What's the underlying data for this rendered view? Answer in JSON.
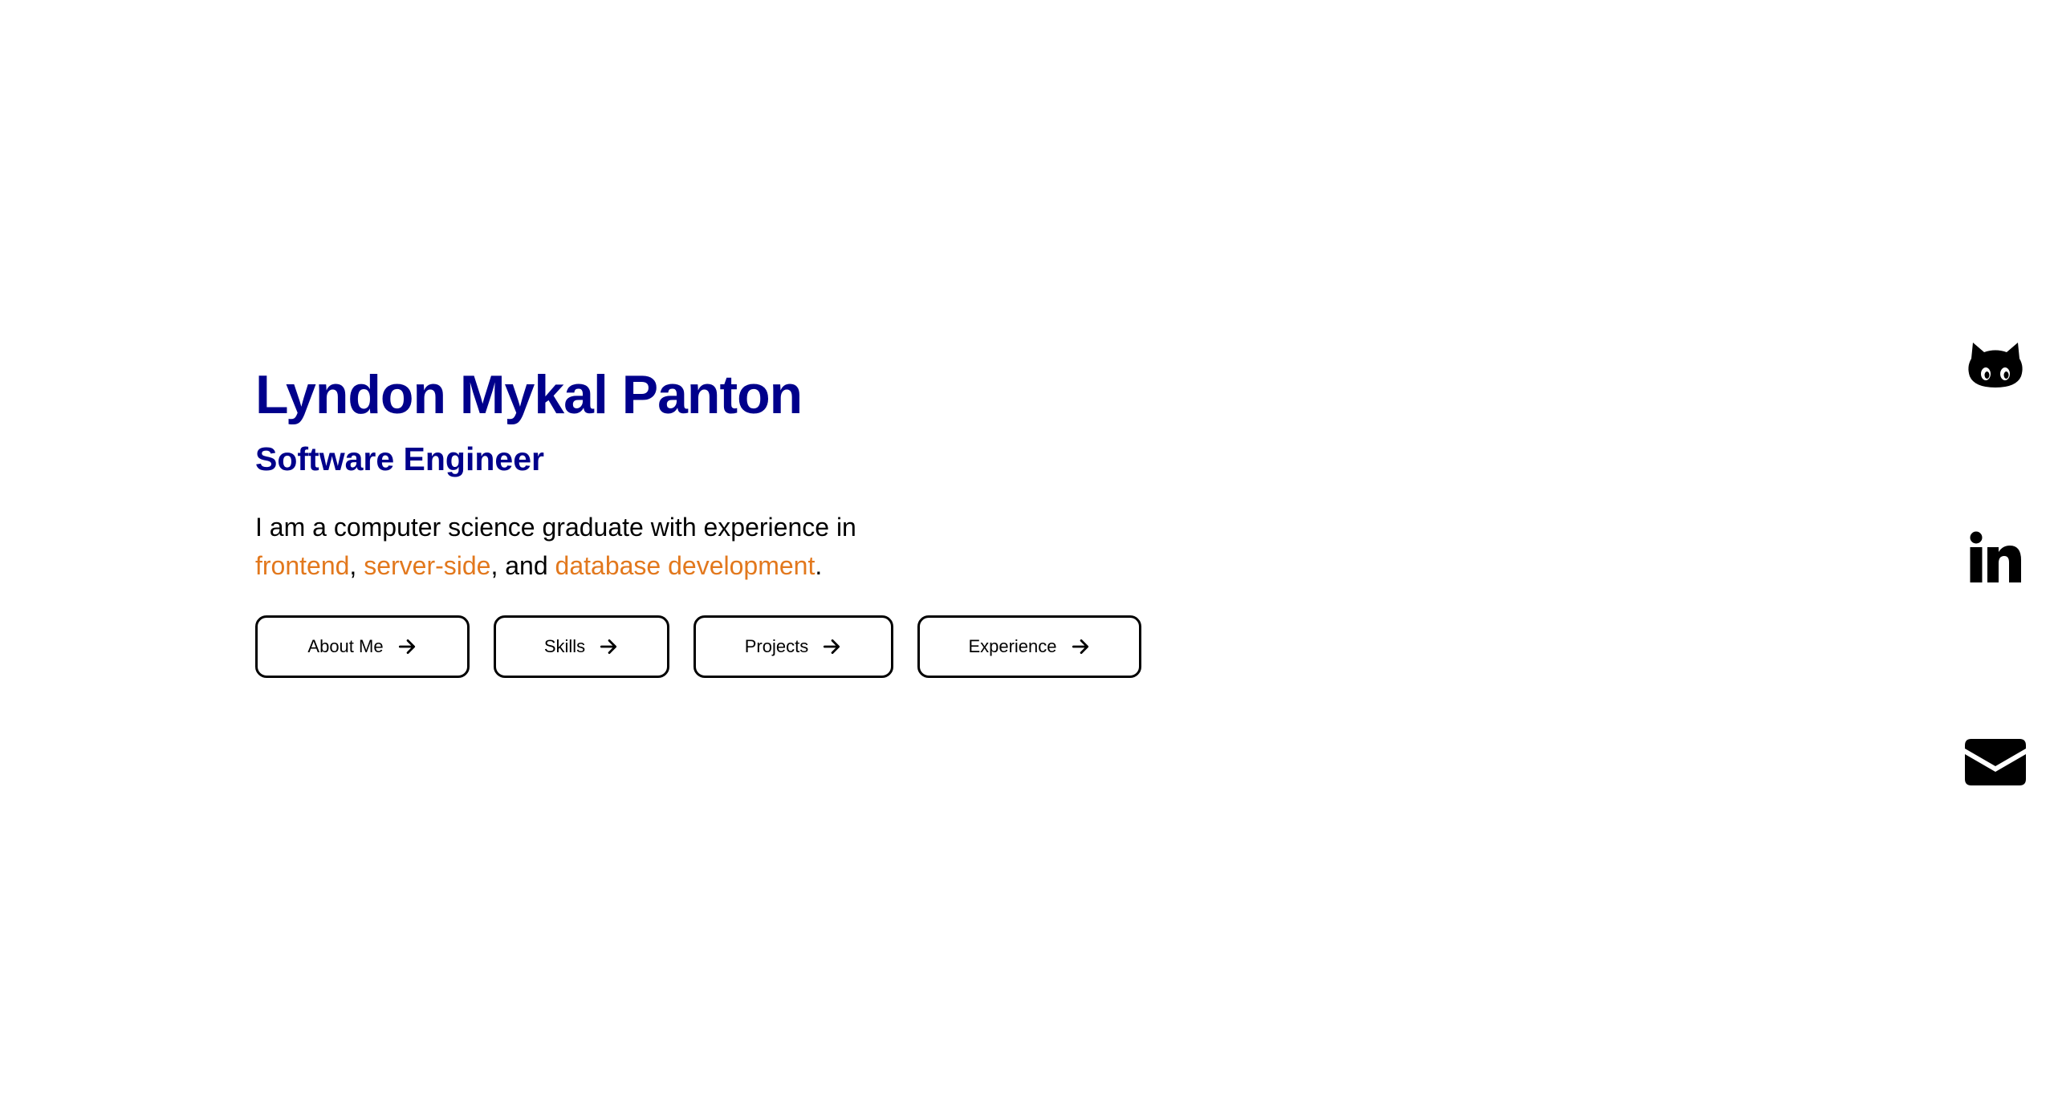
{
  "hero": {
    "name": "Lyndon Mykal Panton",
    "role": "Software Engineer",
    "intro_prefix": "I am a computer science graduate with experience in",
    "highlights": [
      "frontend",
      "server-side",
      "database development"
    ],
    "sep1": ",",
    "sep2": ", and",
    "end": "."
  },
  "buttons": {
    "about": "About Me",
    "skills": "Skills",
    "projects": "Projects",
    "experience": "Experience"
  },
  "social": {
    "icons": [
      "github-icon",
      "linkedin-icon",
      "email-icon"
    ]
  },
  "colors": {
    "name": "#00008b",
    "highlight": "#e2781d",
    "text": "#000000",
    "background": "#ffffff"
  }
}
